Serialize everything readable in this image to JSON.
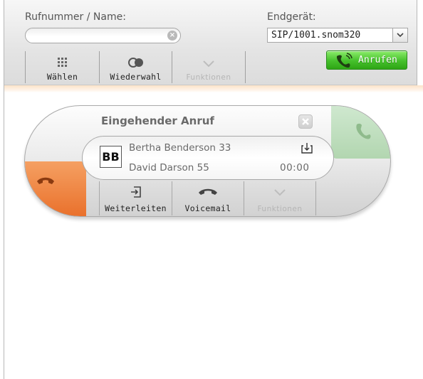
{
  "search": {
    "label": "Rufnummer / Name:",
    "value": ""
  },
  "device": {
    "label": "Endgerät:",
    "selected": "SIP/1001.snom320"
  },
  "toolbar": {
    "dial_label": "Wählen",
    "redial_label": "Wiederwahl",
    "functions_label": "Funktionen",
    "call_label": "Anrufen"
  },
  "incoming": {
    "title": "Eingehender Anruf",
    "avatar_initials": "BB",
    "caller": "Bertha Benderson 33",
    "callee": "David Darson 55",
    "duration": "00:00",
    "forward_label": "Weiterleiten",
    "voicemail_label": "Voicemail",
    "functions_label": "Funktionen"
  },
  "colors": {
    "call_button": "#45c02c",
    "hangup": "#e96f2a",
    "answer": "#b2d6b0",
    "disabled_text": "#b5b5b5"
  },
  "icons": {
    "dial": "keypad-icon",
    "redial": "redial-icon",
    "functions": "chevron-down-icon",
    "call": "phone-call-icon",
    "forward": "forward-icon",
    "voicemail": "voicemail-icon",
    "hangup": "phone-hangup-icon",
    "answer": "phone-answer-icon",
    "close": "close-icon",
    "clear": "clear-icon",
    "download": "download-icon"
  }
}
